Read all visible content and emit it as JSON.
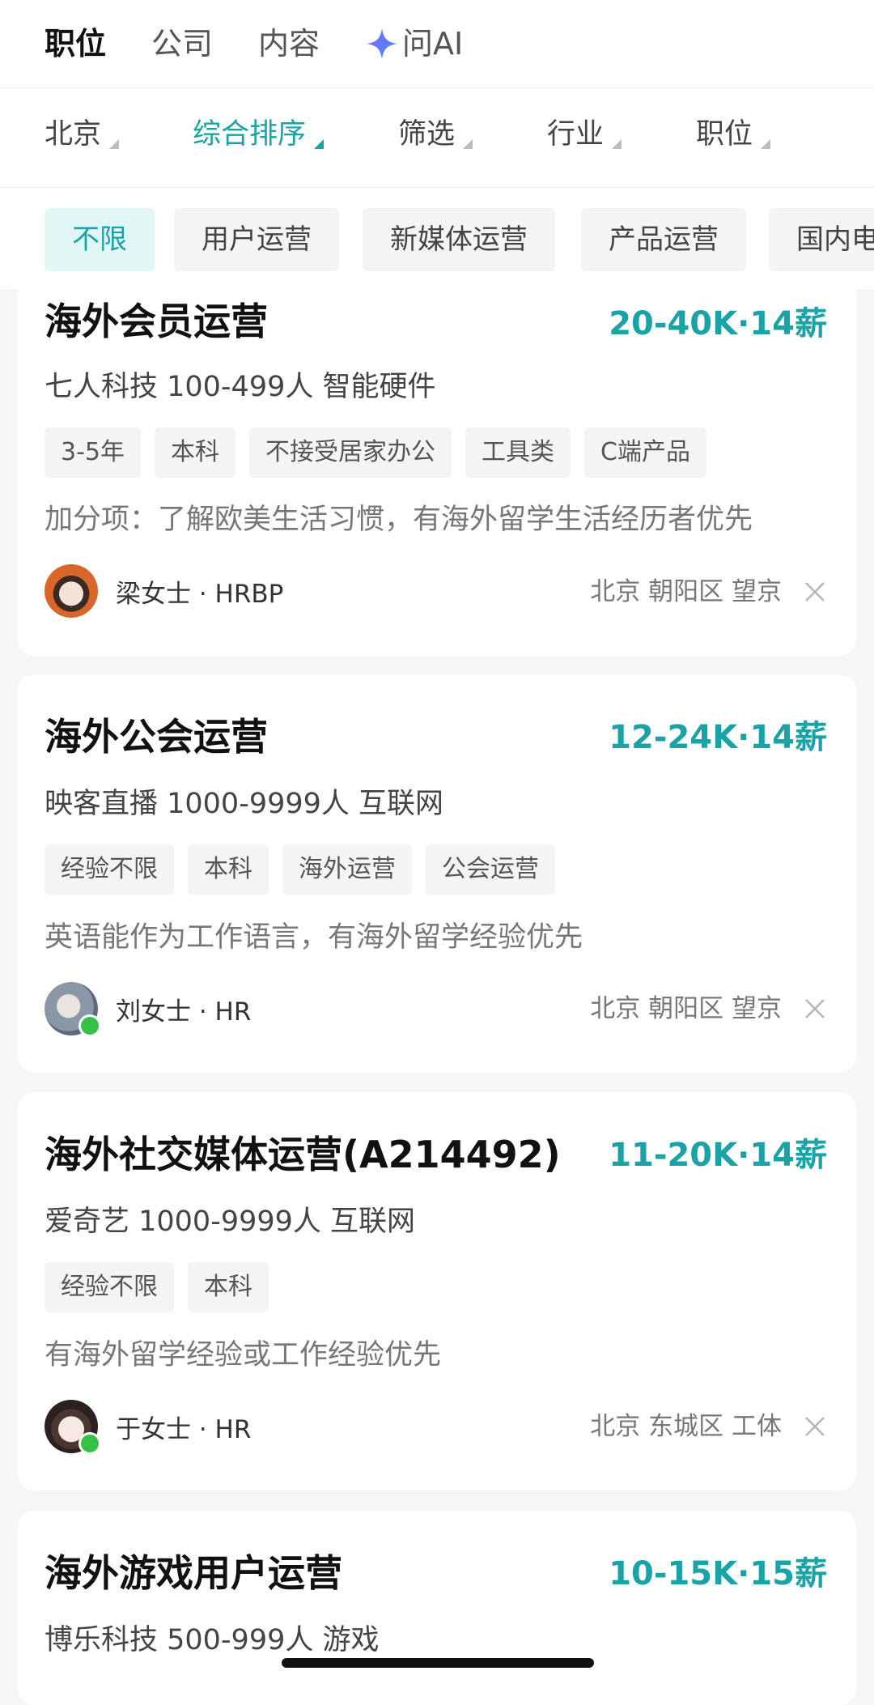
{
  "top_tabs": [
    {
      "label": "职位",
      "active": true
    },
    {
      "label": "公司",
      "active": false
    },
    {
      "label": "内容",
      "active": false
    },
    {
      "label": "问AI",
      "active": false,
      "icon": "sparkle-icon"
    }
  ],
  "filters": [
    {
      "label": "北京",
      "active": false
    },
    {
      "label": "综合排序",
      "active": true
    },
    {
      "label": "筛选",
      "active": false
    },
    {
      "label": "行业",
      "active": false
    },
    {
      "label": "职位",
      "active": false
    }
  ],
  "chips": [
    {
      "label": "不限",
      "active": true
    },
    {
      "label": "用户运营",
      "active": false
    },
    {
      "label": "新媒体运营",
      "active": false
    },
    {
      "label": "产品运营",
      "active": false
    },
    {
      "label": "国内电",
      "active": false
    }
  ],
  "colors": {
    "accent": "#1aa3a6",
    "online": "#36c24a"
  },
  "jobs": [
    {
      "title": "海外会员运营",
      "salary": "20-40K·14薪",
      "company": "七人科技 100-499人 智能硬件",
      "tags": [
        "3-5年",
        "本科",
        "不接受居家办公",
        "工具类",
        "C端产品"
      ],
      "desc": "加分项：了解欧美生活习惯，有海外留学生活经历者优先",
      "recruiter": "梁女士 · HRBP",
      "online": false,
      "location": "北京 朝阳区 望京"
    },
    {
      "title": "海外公会运营",
      "salary": "12-24K·14薪",
      "company": "映客直播 1000-9999人 互联网",
      "tags": [
        "经验不限",
        "本科",
        "海外运营",
        "公会运营"
      ],
      "desc": "英语能作为工作语言，有海外留学经验优先",
      "recruiter": "刘女士 · HR",
      "online": true,
      "location": "北京 朝阳区 望京"
    },
    {
      "title": "海外社交媒体运营(A214492)",
      "salary": "11-20K·14薪",
      "company": "爱奇艺 1000-9999人 互联网",
      "tags": [
        "经验不限",
        "本科"
      ],
      "desc": "有海外留学经验或工作经验优先",
      "recruiter": "于女士 · HR",
      "online": true,
      "location": "北京 东城区 工体"
    },
    {
      "title": "海外游戏用户运营",
      "salary": "10-15K·15薪",
      "company": "博乐科技 500-999人 游戏"
    }
  ]
}
